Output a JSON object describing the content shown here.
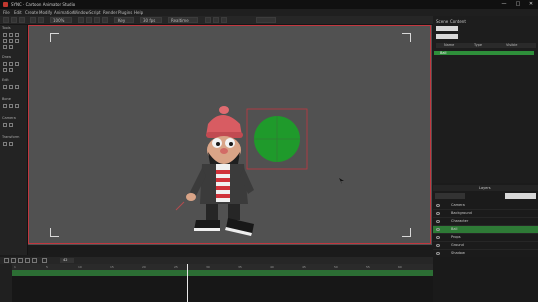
{
  "window": {
    "title": "SYNC · Cartoon Animator Studio",
    "minimize_glyph": "—",
    "maximize_glyph": "□",
    "close_glyph": "✕"
  },
  "menu": [
    "File",
    "Edit",
    "Create",
    "Modify",
    "Animation",
    "Window",
    "Script",
    "Render",
    "Plugins",
    "Help"
  ],
  "toolbar": {
    "zoom_value": "100%",
    "frame_label": "Key",
    "fps_label": "30 fps",
    "play_mode": "Realtime"
  },
  "left_panel": {
    "sections": [
      "Tools",
      "Draw",
      "Edit",
      "Bone",
      "Camera",
      "Transform"
    ]
  },
  "right_panel": {
    "tabs": [
      "Scene",
      "Content"
    ],
    "search_placeholder": "",
    "list_header": [
      "Name",
      "Type",
      "Visible"
    ],
    "selected_item": "Ball"
  },
  "layers": {
    "title": "Layers",
    "rows": [
      {
        "name": "Camera",
        "selected": false
      },
      {
        "name": "Background",
        "selected": false
      },
      {
        "name": "Character",
        "selected": false
      },
      {
        "name": "Ball",
        "selected": true
      },
      {
        "name": "Props",
        "selected": false
      },
      {
        "name": "Ground",
        "selected": false
      },
      {
        "name": "Shadow",
        "selected": false
      }
    ]
  },
  "timeline": {
    "ruler_labels": [
      "1",
      "5",
      "10",
      "15",
      "20",
      "25",
      "30",
      "35",
      "40",
      "45",
      "50",
      "55",
      "60"
    ],
    "frame_counter": "42"
  },
  "colors": {
    "accent_green": "#2e8f3a",
    "selection_red": "#c2373f",
    "ball_green": "#1f9a2b"
  }
}
